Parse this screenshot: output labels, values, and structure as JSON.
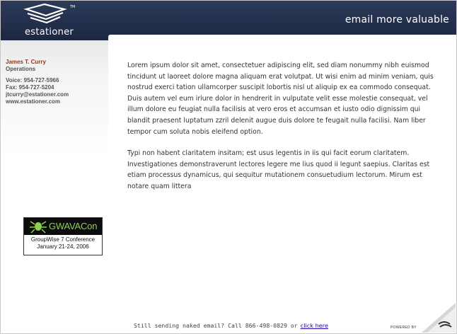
{
  "header": {
    "brand": "estationer",
    "tagline": "email more valuable"
  },
  "contact": {
    "name": "James T. Curry",
    "role": "Operations",
    "voice": "Voice: 954-727-5966",
    "fax": "Fax: 954-727-5204",
    "email": "jtcurry@estationer.com",
    "website": "www.estationer.com"
  },
  "badge": {
    "logo": "GWAVACon",
    "line1": "GroupWise 7 Conference",
    "line2": "January 21-24, 2006"
  },
  "body": {
    "paragraph1": "Lorem ipsum dolor sit amet, consectetuer adipiscing elit, sed diam nonummy nibh euismod tincidunt ut laoreet dolore magna aliquam erat volutpat. Ut wisi enim ad minim veniam, quis nostrud exerci tation ullamcorper suscipit lobortis nisl ut aliquip ex ea commodo consequat. Duis autem vel eum iriure dolor in hendrerit in vulputate velit esse molestie consequat, vel illum dolore eu feugiat nulla facilisis at vero eros et accumsan et iusto odio dignissim qui blandit praesent luptatum zzril delenit augue duis dolore te feugait nulla facilisi. Nam liber tempor cum soluta nobis eleifend option.",
    "paragraph2": "Typi non habent claritatem insitam; est usus legentis in iis qui facit eorum claritatem. Investigationes demonstraverunt lectores legere me lius quod ii legunt saepius. Claritas est etiam processus dynamicus, qui sequitur mutationem consuetudium lectorum. Mirum est notare quam littera"
  },
  "footer": {
    "text": "Still sending naked email? Call 866-498-0829 or",
    "link": "click here",
    "powered_by": "POWERED BY"
  },
  "icons": {
    "logo": "estationer-logo-icon",
    "badge": "gwava-bug-icon",
    "curl": "page-curl-icon"
  },
  "colors": {
    "header": "#1f2a45",
    "name": "#9a3312",
    "badge_green": "#8fd14f",
    "link": "#1a0dab"
  }
}
